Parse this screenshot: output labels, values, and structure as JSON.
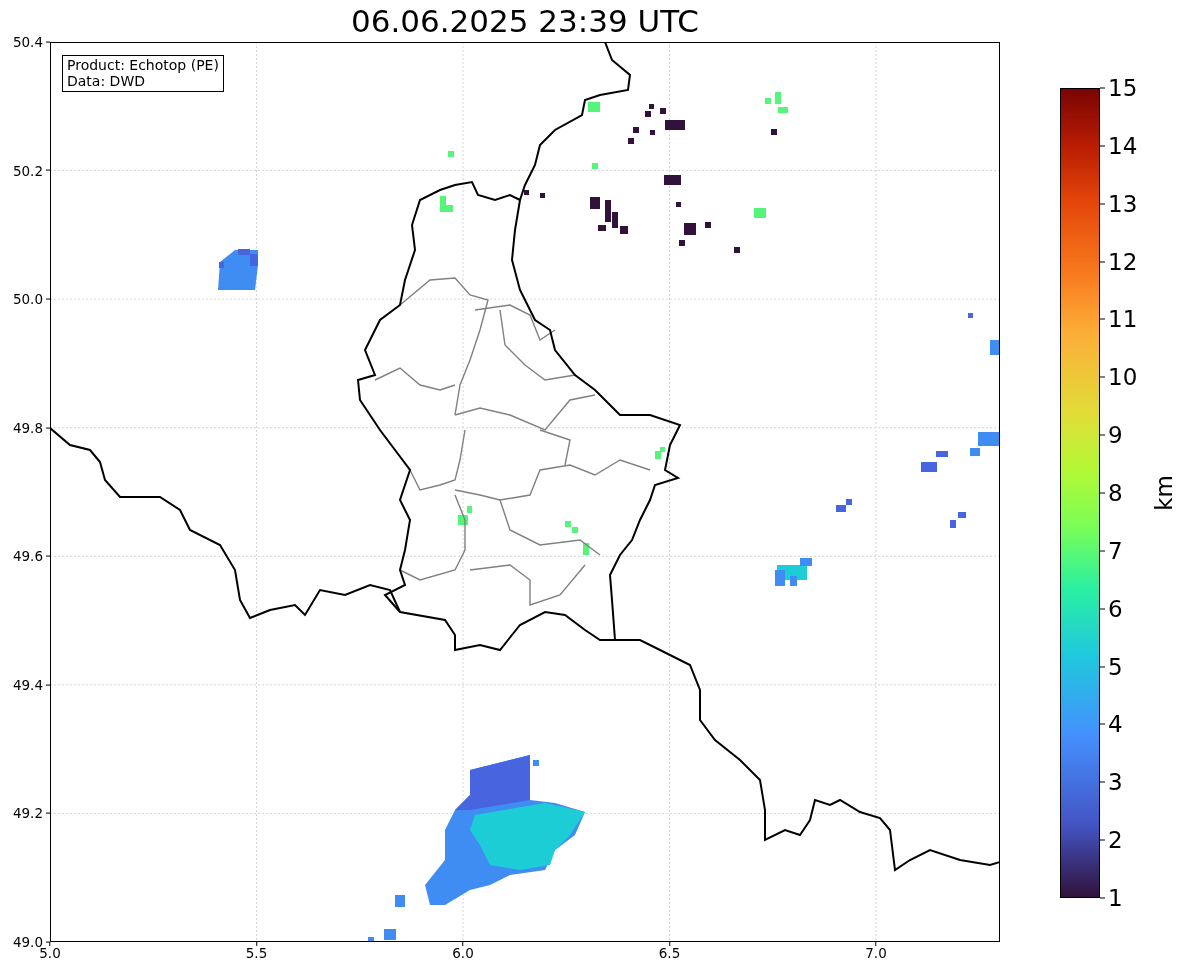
{
  "title": "06.06.2025 23:39 UTC",
  "map": {
    "info_lines": [
      "Product: Echotop (PE)",
      "Data: DWD"
    ],
    "xticks": [
      "5.0",
      "5.5",
      "6.0",
      "6.5",
      "7.0"
    ],
    "yticks": [
      "50.4",
      "50.2",
      "50.0",
      "49.8",
      "49.6",
      "49.4",
      "49.2",
      "49.0"
    ]
  },
  "colorbar": {
    "label": "km",
    "ticks": [
      "15",
      "14",
      "13",
      "12",
      "11",
      "10",
      "9",
      "8",
      "7",
      "6",
      "5",
      "4",
      "3",
      "2",
      "1"
    ]
  }
}
